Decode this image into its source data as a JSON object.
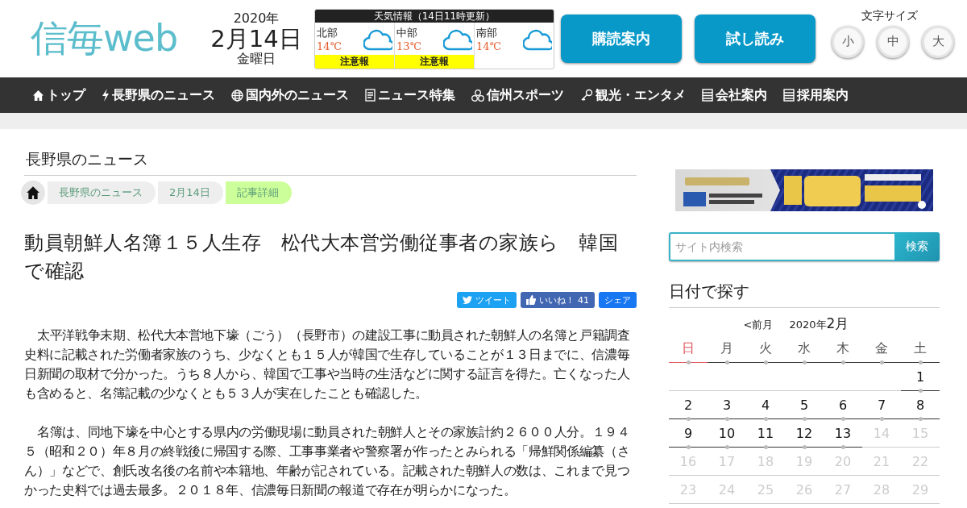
{
  "header": {
    "logo": "信毎web",
    "date": {
      "year": "2020年",
      "day": "2月14日",
      "weekday": "金曜日"
    },
    "weather": {
      "title": "天気情報（14日11時更新）",
      "regions": [
        {
          "name": "北部",
          "temp": "14℃",
          "warning": "注意報"
        },
        {
          "name": "中部",
          "temp": "13℃",
          "warning": "注意報"
        },
        {
          "name": "南部",
          "temp": "14℃"
        }
      ]
    },
    "buttons": [
      "購読案内",
      "試し読み"
    ],
    "font_size": {
      "label": "文字サイズ",
      "options": [
        "小",
        "中",
        "大"
      ]
    }
  },
  "nav": [
    {
      "label": "トップ"
    },
    {
      "label": "長野県のニュース"
    },
    {
      "label": "国内外のニュース"
    },
    {
      "label": "ニュース特集"
    },
    {
      "label": "信州スポーツ"
    },
    {
      "label": "観光・エンタメ"
    },
    {
      "label": "会社案内"
    },
    {
      "label": "採用案内"
    }
  ],
  "section_title": "長野県のニュース",
  "breadcrumb": [
    {
      "label": "長野県のニュース",
      "selected": false
    },
    {
      "label": "2月14日",
      "selected": false
    },
    {
      "label": "記事詳細",
      "selected": true
    }
  ],
  "article": {
    "title": "動員朝鮮人名簿１５人生存　松代大本営労働従事者の家族ら　韓国で確認",
    "share": [
      {
        "kind": "tweet",
        "label": "ツイート"
      },
      {
        "kind": "like",
        "label": "いいね！",
        "count": "41"
      },
      {
        "kind": "share",
        "label": "シェア"
      }
    ],
    "paragraphs": [
      "太平洋戦争末期、松代大本営地下壕（ごう）（長野市）の建設工事に動員された朝鮮人の名簿と戸籍調査史料に記載された労働者家族のうち、少なくとも１５人が韓国で生存していることが１３日までに、信濃毎日新聞の取材で分かった。うち８人から、韓国で工事や当時の生活などに関する証言を得た。亡くなった人も含めると、名簿記載の少なくとも５３人が実在したことも確認した。",
      "名簿は、同地下壕を中心とする県内の労働現場に動員された朝鮮人とその家族計約２６００人分。１９４５（昭和２０）年８月の終戦後に帰国する際、工事事業者や警察署が作ったとみられる「帰鮮関係編纂（さん）」などで、創氏改名後の名前や本籍地、年齢が記されている。記載された朝鮮人の数は、これまで見つかった史料では過去最多。２０１８年、信濃毎日新聞の報道で存在が明らかになった。"
    ]
  },
  "sidebar": {
    "search": {
      "placeholder": "サイト内検索",
      "button": "検索"
    },
    "calendar": {
      "title": "日付で探す",
      "prev": "<前月",
      "year": "2020年",
      "month": "2月",
      "weekdays": [
        {
          "label": "日",
          "kind": "sunday"
        },
        {
          "label": "月",
          "kind": "weekday"
        },
        {
          "label": "火",
          "kind": "weekday"
        },
        {
          "label": "水",
          "kind": "weekday"
        },
        {
          "label": "木",
          "kind": "weekday"
        },
        {
          "label": "金",
          "kind": "weekday"
        },
        {
          "label": "土",
          "kind": "weekday"
        }
      ],
      "weeks": [
        [
          {
            "day": "1",
            "active": true
          }
        ],
        [
          {
            "day": "2",
            "active": true
          },
          {
            "day": "3",
            "active": true
          },
          {
            "day": "4",
            "active": true
          },
          {
            "day": "5",
            "active": true
          },
          {
            "day": "6",
            "active": true
          },
          {
            "day": "7",
            "active": true
          },
          {
            "day": "8",
            "active": true
          }
        ],
        [
          {
            "day": "9",
            "active": true
          },
          {
            "day": "10",
            "active": true
          },
          {
            "day": "11",
            "active": true
          },
          {
            "day": "12",
            "active": true
          },
          {
            "day": "13",
            "active": true
          },
          {
            "day": "14",
            "active": false
          },
          {
            "day": "15",
            "active": false
          }
        ],
        [
          {
            "day": "16",
            "active": false
          },
          {
            "day": "17",
            "active": false
          },
          {
            "day": "18",
            "active": false
          },
          {
            "day": "19",
            "active": false
          },
          {
            "day": "20",
            "active": false
          },
          {
            "day": "21",
            "active": false
          },
          {
            "day": "22",
            "active": false
          }
        ],
        [
          {
            "day": "23",
            "active": false
          },
          {
            "day": "24",
            "active": false
          },
          {
            "day": "25",
            "active": false
          },
          {
            "day": "26",
            "active": false
          },
          {
            "day": "27",
            "active": false
          },
          {
            "day": "28",
            "active": false
          },
          {
            "day": "29",
            "active": false
          }
        ]
      ]
    }
  }
}
